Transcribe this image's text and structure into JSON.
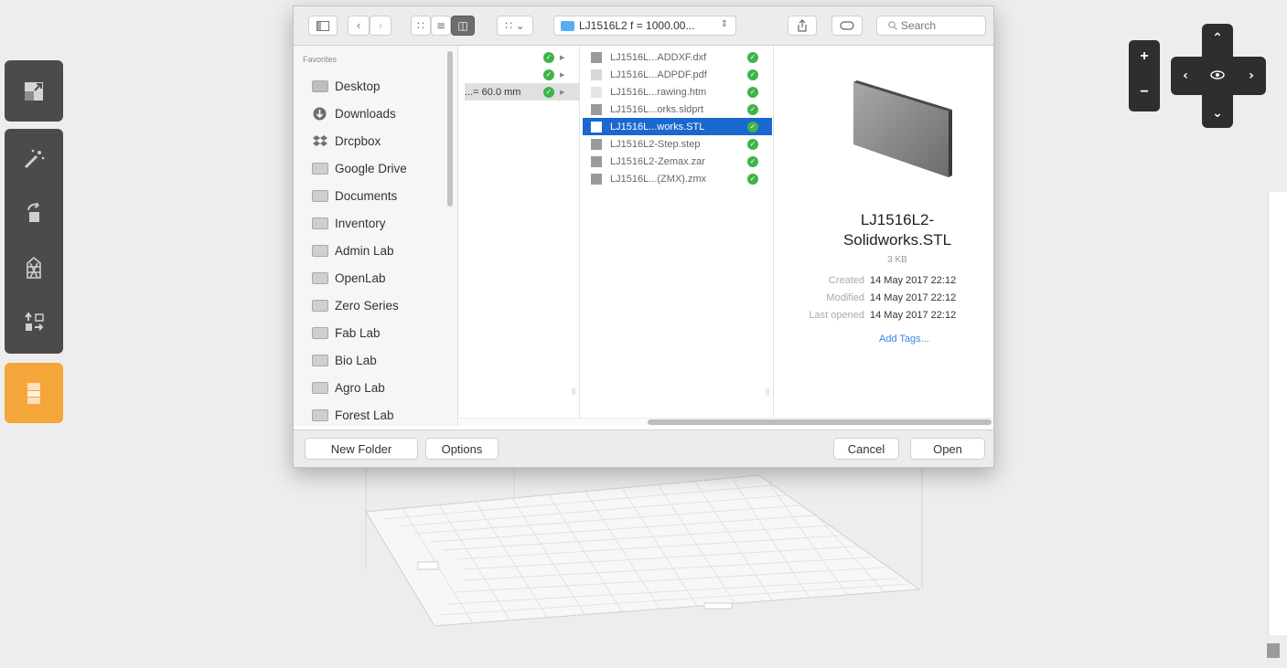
{
  "toolbar": {
    "path_popup": "LJ1516L2 f = 1000.00...",
    "search_placeholder": "Search"
  },
  "sidebar": {
    "section_label": "Favorites",
    "items": [
      {
        "label": "Desktop",
        "icon": "desktop-icon"
      },
      {
        "label": "Downloads",
        "icon": "downloads-icon"
      },
      {
        "label": "Drcpbox",
        "icon": "dropbox-icon"
      },
      {
        "label": "Google Drive",
        "icon": "folder-icon"
      },
      {
        "label": "Documents",
        "icon": "folder-icon"
      },
      {
        "label": "Inventory",
        "icon": "folder-icon"
      },
      {
        "label": "Admin Lab",
        "icon": "folder-icon"
      },
      {
        "label": "OpenLab",
        "icon": "folder-icon"
      },
      {
        "label": "Zero Series",
        "icon": "folder-icon"
      },
      {
        "label": "Fab Lab",
        "icon": "folder-icon"
      },
      {
        "label": "Bio Lab",
        "icon": "folder-icon"
      },
      {
        "label": "Agro Lab",
        "icon": "folder-icon"
      },
      {
        "label": "Forest Lab",
        "icon": "folder-icon"
      }
    ]
  },
  "column1": {
    "rows": [
      {
        "label": ""
      },
      {
        "label": ""
      },
      {
        "label": "...= 60.0 mm"
      }
    ]
  },
  "column2": {
    "files": [
      {
        "name": "LJ1516L...ADDXF.dxf",
        "selected": false
      },
      {
        "name": "LJ1516L...ADPDF.pdf",
        "selected": false
      },
      {
        "name": "LJ1516L...rawing.htm",
        "selected": false
      },
      {
        "name": "LJ1516L...orks.sldprt",
        "selected": false
      },
      {
        "name": "LJ1516L...works.STL",
        "selected": true
      },
      {
        "name": "LJ1516L2-Step.step",
        "selected": false
      },
      {
        "name": "LJ1516L2-Zemax.zar",
        "selected": false
      },
      {
        "name": "LJ1516L...(ZMX).zmx",
        "selected": false
      }
    ]
  },
  "preview": {
    "name_line1": "LJ1516L2-",
    "name_line2": "Solidworks.STL",
    "size": "3 KB",
    "created_label": "Created",
    "created_value": "14 May 2017 22:12",
    "modified_label": "Modified",
    "modified_value": "14 May 2017 22:12",
    "opened_label": "Last opened",
    "opened_value": "14 May 2017 22:12",
    "add_tags": "Add Tags..."
  },
  "buttons": {
    "new_folder": "New Folder",
    "options": "Options",
    "cancel": "Cancel",
    "open": "Open"
  },
  "view_controls": {
    "zoom_in": "+",
    "zoom_out": "−"
  },
  "colors": {
    "selection": "#1a67d0",
    "sync_ok": "#3fb44a",
    "app_accent": "#f4a63a",
    "app_toolbar": "#4b4b4d"
  }
}
